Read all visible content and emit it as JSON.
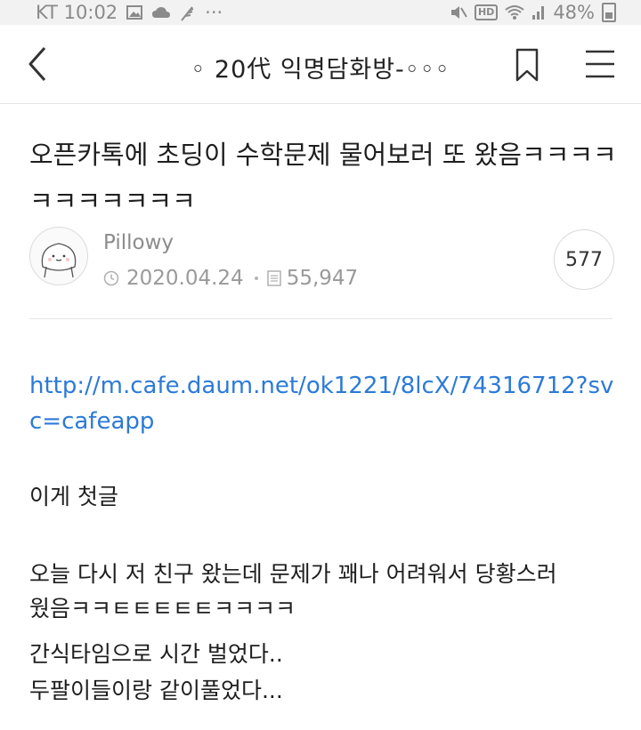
{
  "status_bar": {
    "carrier_time": "KT 10:02",
    "extra": "···",
    "hd": "HD",
    "battery": "48%"
  },
  "header": {
    "title": "◦ 20代 익명담화방-◦◦◦"
  },
  "post": {
    "title": "오픈카톡에 초딩이 수학문제 물어보러 또 왔음ㅋㅋㅋㅋㅋㅋㅋㅋㅋㅋㅋ",
    "author": "Pillowy",
    "date": "2020.04.24",
    "views": "55,947",
    "comment_count": "577"
  },
  "body": {
    "link": "http://m.cafe.daum.net/ok1221/8lcX/74316712?svc=cafeapp",
    "paragraphs": [
      "이게 첫글",
      "오늘 다시 저 친구 왔는데 문제가 꽤나 어려워서 당황스러",
      "웠음ㅋㅋㅌㅌㅌㅌㅌㅋㅋㅋㅋ",
      "간식타임으로 시간 벌었다..",
      "두팔이들이랑 같이풀었다..."
    ]
  },
  "icons": {
    "back": "chevron-left-icon",
    "bookmark": "bookmark-icon",
    "menu": "hamburger-menu-icon",
    "clock": "clock-icon",
    "views": "document-icon"
  },
  "colors": {
    "link": "#2c7ad8",
    "status_bar_bg": "#f2f2f2",
    "meta_text": "#9a9a9a"
  }
}
